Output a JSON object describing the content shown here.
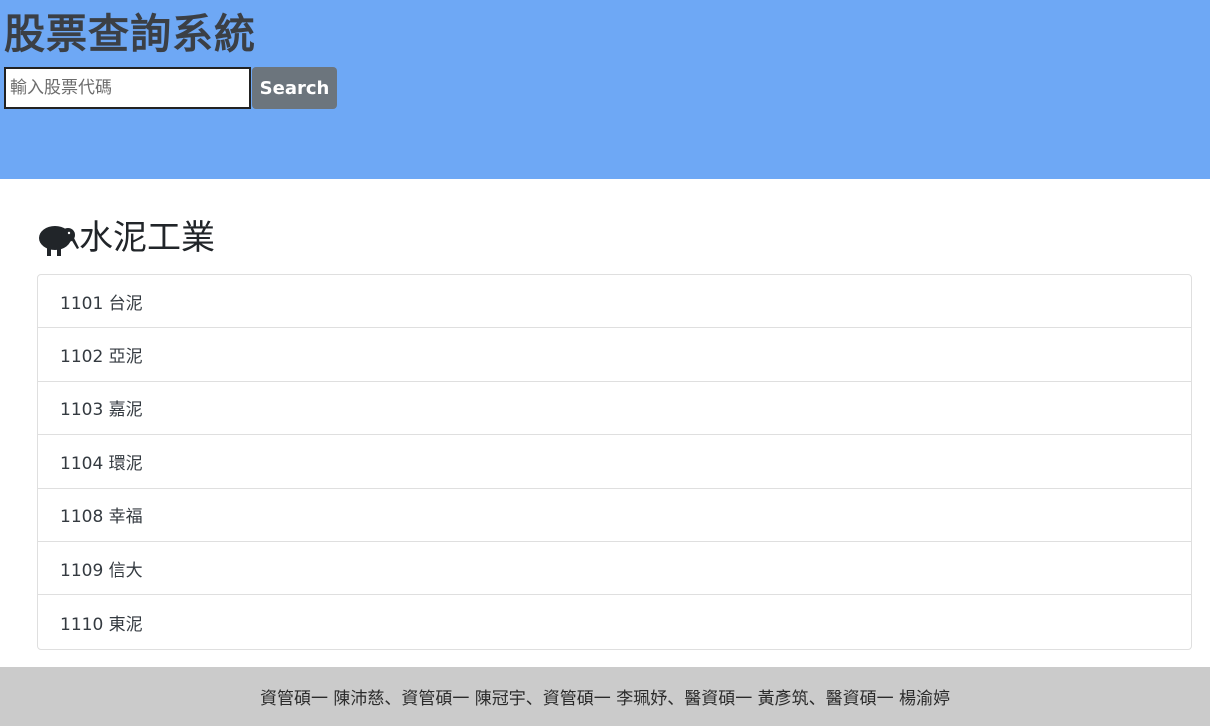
{
  "header": {
    "title": "股票查詢系統",
    "search": {
      "placeholder": "輸入股票代碼",
      "value": "",
      "button_label": "Search"
    },
    "background_color": "#6ea8f5"
  },
  "category": {
    "icon": "kiwi-bird-icon",
    "title": "水泥工業"
  },
  "stocks": [
    {
      "label": "1101 台泥"
    },
    {
      "label": "1102 亞泥"
    },
    {
      "label": "1103 嘉泥"
    },
    {
      "label": "1104 環泥"
    },
    {
      "label": "1108 幸福"
    },
    {
      "label": "1109 信大"
    },
    {
      "label": "1110 東泥"
    }
  ],
  "footer": {
    "text": "資管碩一 陳沛慈、資管碩一 陳冠宇、資管碩一 李珮妤、醫資碩一 黃彥筑、醫資碩一 楊渝婷"
  }
}
